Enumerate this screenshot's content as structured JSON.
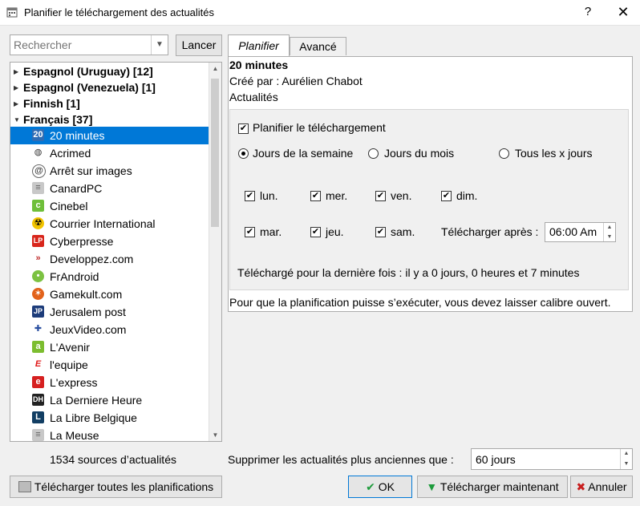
{
  "window": {
    "title": "Planifier le téléchargement des actualités",
    "help": "?",
    "close": "✕"
  },
  "search": {
    "placeholder": "Rechercher",
    "button": "Lancer"
  },
  "tree": {
    "groups": [
      {
        "label": "Espagnol (Uruguay) [12]"
      },
      {
        "label": "Espagnol (Venezuela) [1]"
      },
      {
        "label": "Finnish [1]"
      },
      {
        "label": "Français [37]"
      }
    ],
    "items": [
      {
        "label": "20 minutes",
        "icon": "20-icon",
        "selected": true
      },
      {
        "label": "Acrimed",
        "icon": "globe-icon"
      },
      {
        "label": "Arrêt sur images",
        "icon": "at-icon"
      },
      {
        "label": "CanardPC",
        "icon": "newspaper-icon"
      },
      {
        "label": "Cinebel",
        "icon": "cinebel-icon"
      },
      {
        "label": "Courrier International",
        "icon": "radiation-icon"
      },
      {
        "label": "Cyberpresse",
        "icon": "lp-icon"
      },
      {
        "label": "Developpez.com",
        "icon": "developpez-icon"
      },
      {
        "label": "FrAndroid",
        "icon": "frandroid-icon"
      },
      {
        "label": "Gamekult.com",
        "icon": "gamekult-icon"
      },
      {
        "label": "Jerusalem post",
        "icon": "jp-icon"
      },
      {
        "label": "JeuxVideo.com",
        "icon": "gamepad-icon"
      },
      {
        "label": "L'Avenir",
        "icon": "avenir-icon"
      },
      {
        "label": "l'equipe",
        "icon": "equipe-icon"
      },
      {
        "label": "L'express",
        "icon": "express-icon"
      },
      {
        "label": "La Derniere Heure",
        "icon": "dh-icon"
      },
      {
        "label": "La Libre Belgique",
        "icon": "libre-icon"
      },
      {
        "label": "La Meuse",
        "icon": "newspaper-icon"
      }
    ],
    "count": "1534 sources d’actualités"
  },
  "tabs": {
    "planifier": "Planifier",
    "avance": "Avancé"
  },
  "feed": {
    "title": "20 minutes",
    "created_by": "Créé par : Aurélien Chabot",
    "category": "Actualités"
  },
  "schedule": {
    "enable_label": "Planifier le téléchargement",
    "enabled": true,
    "mode_week": "Jours de la semaine",
    "mode_month": "Jours du mois",
    "mode_every": "Tous les x jours",
    "days": {
      "lun": "lun.",
      "mer": "mer.",
      "ven": "ven.",
      "dim": "dim.",
      "mar": "mar.",
      "jeu": "jeu.",
      "sam": "sam."
    },
    "after_label": "Télécharger après :",
    "time": "06:00 Am",
    "last": "Téléchargé pour la dernière fois : il y a 0 jours, 0 heures et 7 minutes"
  },
  "info": "Pour que la planification puisse s’exécuter, vous devez laisser calibre ouvert.",
  "delete": {
    "label": "Supprimer les actualités plus anciennes que :",
    "value": "60 jours"
  },
  "buttons": {
    "download_all": "Télécharger toutes les planifications",
    "ok": "OK",
    "download_now": "Télécharger maintenant",
    "cancel": "Annuler"
  },
  "colors": {
    "selection": "#0078d7",
    "ok_border": "#0078d7",
    "check_green": "#1e9b3c",
    "cancel_red": "#c81e1e"
  }
}
